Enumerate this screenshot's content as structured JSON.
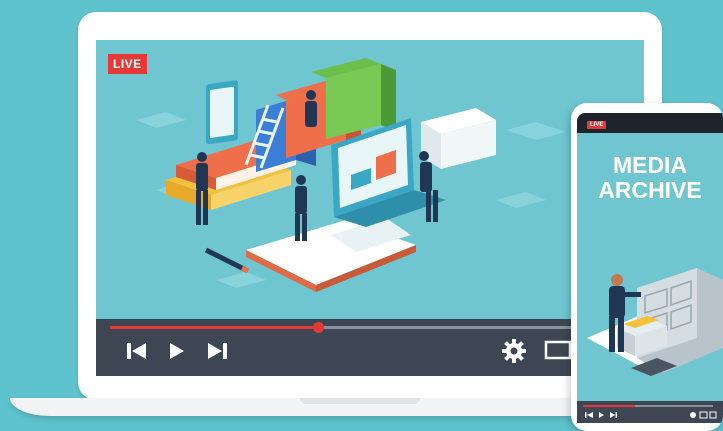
{
  "player": {
    "live_label": "LIVE",
    "progress_percent": 40,
    "controls": {
      "skip_back_icon": "skip-previous-icon",
      "play_icon": "play-icon",
      "skip_forward_icon": "skip-next-icon",
      "settings_icon": "gear-icon",
      "fullscreen_icon": "fullscreen-icon"
    }
  },
  "phone": {
    "live_label": "LIVE",
    "title_line1": "MEDIA",
    "title_line2": "ARCHIVE",
    "progress_percent": 40
  },
  "colors": {
    "background": "#5fc3cd",
    "screen": "#6fc6d1",
    "control_bar": "#3d4652",
    "accent_red": "#e53935"
  }
}
